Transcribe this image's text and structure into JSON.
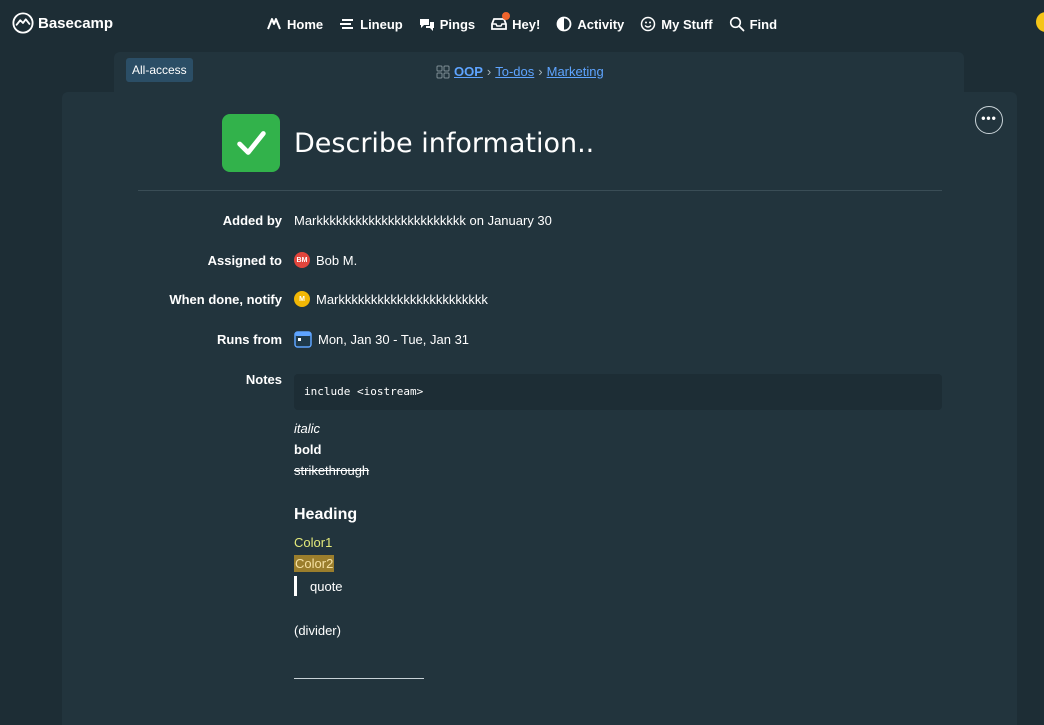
{
  "app": {
    "name": "Basecamp"
  },
  "nav": {
    "items": [
      {
        "label": "Home",
        "icon": "home-icon"
      },
      {
        "label": "Lineup",
        "icon": "lineup-icon"
      },
      {
        "label": "Pings",
        "icon": "pings-icon"
      },
      {
        "label": "Hey!",
        "icon": "hey-icon"
      },
      {
        "label": "Activity",
        "icon": "activity-icon"
      },
      {
        "label": "My Stuff",
        "icon": "smiley-icon"
      },
      {
        "label": "Find",
        "icon": "search-icon"
      }
    ]
  },
  "breadcrumb": {
    "access_badge": "All-access",
    "project": "OOP",
    "sep1": "›",
    "list": "To-dos",
    "sep2": "›",
    "group": "Marketing"
  },
  "todo": {
    "title": "Describe information..",
    "completed": true,
    "more_label": "•••"
  },
  "details": {
    "added_by_label": "Added by",
    "added_by_value": "Markkkkkkkkkkkkkkkkkkkkkkk on January 30",
    "assigned_label": "Assigned to",
    "assigned_initials": "BM",
    "assigned_value": "Bob M.",
    "notify_label": "When done, notify",
    "notify_initials": "M",
    "notify_value": "Markkkkkkkkkkkkkkkkkkkkkkk",
    "runs_label": "Runs from",
    "runs_value": "Mon, Jan 30 - Tue, Jan 31",
    "notes_label": "Notes"
  },
  "notes": {
    "code": "include <iostream>",
    "italic": "italic",
    "bold": "bold",
    "strike": "strikethrough",
    "heading": "Heading",
    "color1": "Color1",
    "color2": "Color2",
    "quote": "quote",
    "divider": "(divider)"
  },
  "colors": {
    "background": "#1d2d35",
    "card": "#22343d",
    "link": "#5ea4ff",
    "check_green": "#32b24b",
    "avatar_bm": "#e2453c",
    "avatar_m": "#f2b705"
  }
}
